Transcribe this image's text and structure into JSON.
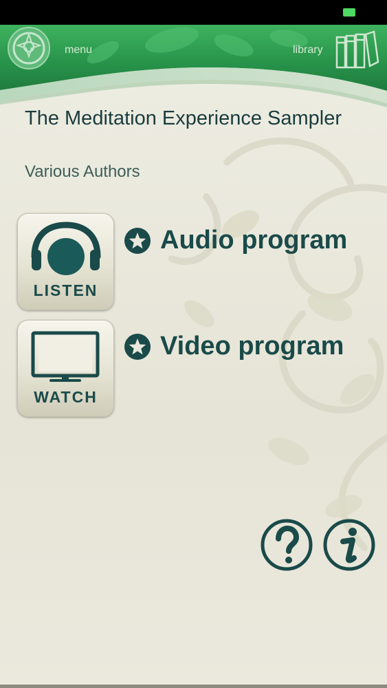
{
  "header": {
    "menu_label": "menu",
    "library_label": "library"
  },
  "book": {
    "title": "The Meditation Experience Sampler",
    "author": "Various Authors"
  },
  "actions": {
    "listen_label": "LISTEN",
    "watch_label": "WATCH"
  },
  "programs": {
    "audio_label": "Audio program",
    "video_label": "Video program"
  },
  "help": {
    "help_icon": "question-mark-icon",
    "info_icon": "info-icon"
  },
  "colors": {
    "header_green": "#2e9a4f",
    "teal_dark": "#1a4a4a",
    "background": "#e9e8dc"
  }
}
